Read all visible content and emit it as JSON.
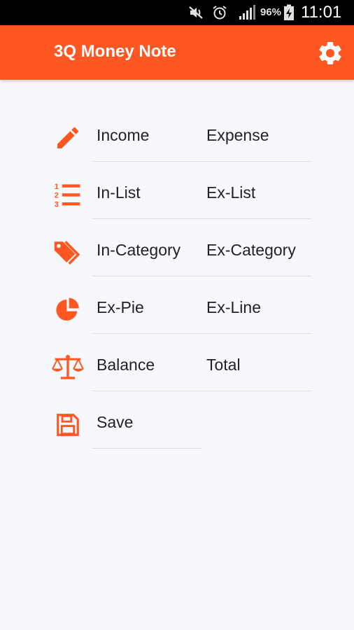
{
  "status_bar": {
    "battery_percent": "96%",
    "time": "11:01"
  },
  "app_bar": {
    "title": "3Q Money Note",
    "settings_icon": "gear-icon"
  },
  "accent_color": "#ff5722",
  "menu": [
    {
      "icon": "pencil-icon",
      "left": "Income",
      "right": "Expense"
    },
    {
      "icon": "numbered-list-icon",
      "left": "In-List",
      "right": "Ex-List"
    },
    {
      "icon": "tags-icon",
      "left": "In-Category",
      "right": "Ex-Category"
    },
    {
      "icon": "pie-chart-icon",
      "left": "Ex-Pie",
      "right": "Ex-Line"
    },
    {
      "icon": "balance-scale-icon",
      "left": "Balance",
      "right": "Total"
    },
    {
      "icon": "floppy-disk-icon",
      "left": "Save"
    }
  ]
}
